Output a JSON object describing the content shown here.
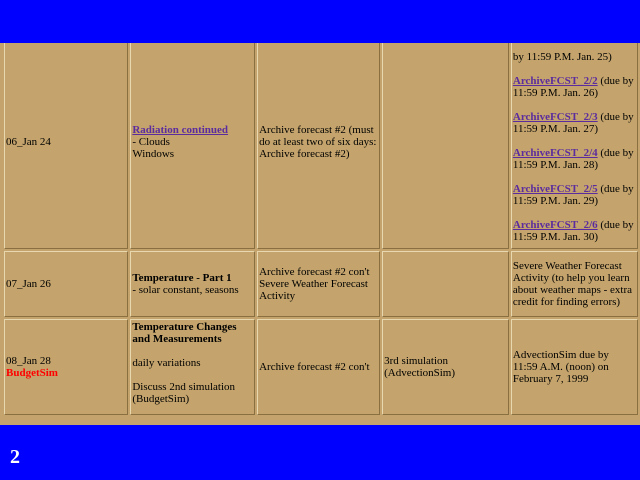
{
  "slide_number": "2",
  "rows": [
    {
      "date": "06_Jan 24",
      "topic_link": "Radiation continued",
      "topic_lines": [
        "- Clouds",
        "Windows"
      ],
      "assignment": "Archive forecast #2 (must do at least two of six days: Archive forecast #2)",
      "simulation": "",
      "due_top_cut": "by 11:59 P.M. Jan. 25)",
      "due_items": [
        {
          "link": "ArchiveFCST_2/2",
          "text": " (due by 11:59 P.M. Jan. 26)"
        },
        {
          "link": "ArchiveFCST_2/3",
          "text": " (due by 11:59 P.M. Jan. 27)"
        },
        {
          "link": "ArchiveFCST_2/4",
          "text": " (due by 11:59 P.M. Jan. 28)"
        },
        {
          "link": "ArchiveFCST_2/5",
          "text": " (due by 11:59 P.M. Jan. 29)"
        },
        {
          "link": "ArchiveFCST_2/6",
          "text": " (due by 11:59 P.M. Jan. 30)"
        }
      ]
    },
    {
      "date": "07_Jan 26",
      "topic_bold": "Temperature - Part 1",
      "topic_lines": [
        "- solar constant, seasons"
      ],
      "assignment": "Archive forecast #2 con't Severe Weather Forecast Activity",
      "simulation": "",
      "due": "Severe Weather Forecast Activity (to help you learn about weather maps - extra credit for finding errors)"
    },
    {
      "date": "08_Jan 28",
      "date_extra": "BudgetSim",
      "topic_bold": "Temperature Changes and Measurements",
      "topic_line2": "daily variations",
      "topic_line3": "Discuss 2nd simulation (BudgetSim)",
      "assignment": "Archive forecast #2 con't",
      "simulation": "3rd simulation (AdvectionSim)",
      "due": "AdvectionSim due by 11:59 A.M. (noon) on February 7, 1999"
    }
  ],
  "colors": {
    "background": "#0000ff",
    "table_bg": "#c4a46c",
    "link": "#5b2c9e",
    "red": "#ff0000"
  }
}
